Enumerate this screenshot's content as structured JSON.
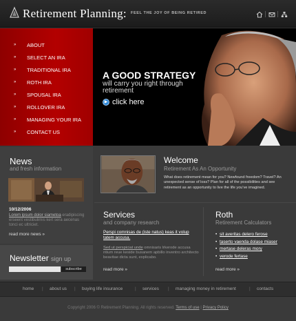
{
  "header": {
    "title": "Retirement Planning:",
    "tagline": "FEEL THE JOY OF BEING RETIRED",
    "icons": [
      "home-icon",
      "mail-icon",
      "sitemap-icon"
    ]
  },
  "nav": {
    "items": [
      {
        "label": "ABOUT"
      },
      {
        "label": "SELECT AN IRA"
      },
      {
        "label": "TRADITIONAL IRA"
      },
      {
        "label": "ROTH IRA"
      },
      {
        "label": "SPOUSAL IRA"
      },
      {
        "label": "ROLLOVER IRA"
      },
      {
        "label": "MANAGING YOUR IRA"
      },
      {
        "label": "CONTACT US"
      }
    ],
    "bullet": "»"
  },
  "hero": {
    "headline": "A GOOD STRATEGY",
    "subtitle": "will carry you right through retirement",
    "cta_label": "click here"
  },
  "news": {
    "title": "News",
    "subtitle": "and fresh information",
    "date": "10/12/2006",
    "lead": "Lorem ipsum dolor siametoa",
    "text": "eradipiscing erseent vestibulimis kert sera aecenas tonci ec ultriciet.",
    "more": "read more news »"
  },
  "newsletter": {
    "title": "Newsletter",
    "title_suffix": "sign up",
    "input_value": "",
    "button": "subscribe"
  },
  "welcome": {
    "title": "Welcome",
    "subtitle": "Retirement As An Opportunity",
    "text": "What does retirement mean for you? Newfound freedom? Travel? An unexpected sense of loss? Plan for all of the possibilities and see retirement as an opportunity to live the life you've imagined."
  },
  "services": {
    "title": "Services",
    "subtitle": "and company research",
    "lead": "Perspi comnisas de (iste natus) keas it volup tatem accusa.",
    "text_lead": "Sed ut perspiciat unde",
    "text": " omnisaris lrkerode accusa ntium reue keside busanem apbillo inventro architecto beavitae dicta sunt, explicabo.",
    "more": "read more »"
  },
  "roth": {
    "title": "Roth",
    "subtitle": "Retirement Calculators",
    "links": [
      "sit averitas delero ferose",
      "taserto vaenda dolase miaser",
      "mertase deleras mory",
      "verode fertase"
    ],
    "more": "read more »"
  },
  "footer": {
    "nav": [
      "home",
      "about us",
      "buying life insurance",
      "services",
      "managing money in retirement",
      "contacts"
    ],
    "copyright": "Copyright 2006 © Retirement Planning. All rights reserved.",
    "terms": "Terms of use",
    "privacy": "Privacy Policy",
    "sep": "|"
  },
  "colors": {
    "nav_red": "#b30000",
    "background": "#3a3a3a",
    "accent_blue": "#2d87d6"
  }
}
